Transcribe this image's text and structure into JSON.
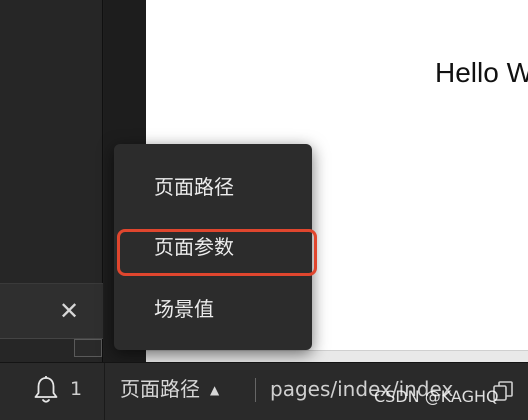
{
  "simulator": {
    "hello_text": "Hello W"
  },
  "menu": {
    "items": [
      {
        "label": "页面路径"
      },
      {
        "label": "页面参数"
      },
      {
        "label": "场景值"
      }
    ]
  },
  "left_pane": {
    "close_glyph": "✕"
  },
  "statusbar": {
    "notification_count": "1",
    "page_path_label": "页面路径",
    "caret": "▲",
    "path_value": "pages/index/index"
  },
  "watermark": "CSDN @KAGHQ",
  "icons": {
    "bell": "bell-icon",
    "copy": "copy-icon",
    "close": "close-icon",
    "caret": "caret-up-icon"
  },
  "colors": {
    "highlight": "#e0462e",
    "menu_bg": "#2c2c2c",
    "statusbar_bg": "#2a2a2a"
  }
}
